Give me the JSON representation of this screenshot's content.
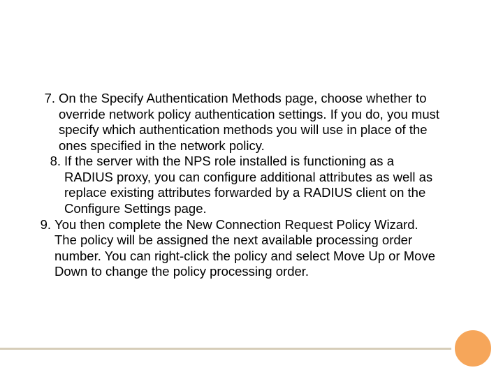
{
  "items": [
    {
      "number": "7.",
      "text": "On the Specify Authentication Methods page, choose whether to override network policy authentication settings. If you do, you must specify which authentication methods you will use in place of the ones specified in the network policy."
    },
    {
      "number": "8.",
      "text": "If the server with the NPS role installed is functioning as a RADIUS proxy, you can configure additional attributes as well as replace existing attributes forwarded by a RADIUS client on the Configure Settings page."
    },
    {
      "number": "9.",
      "text": "You then complete the New Connection Request Policy Wizard. The policy will be assigned the next available processing order number. You can right-click the policy and select Move Up or Move Down to change the policy processing order."
    }
  ]
}
